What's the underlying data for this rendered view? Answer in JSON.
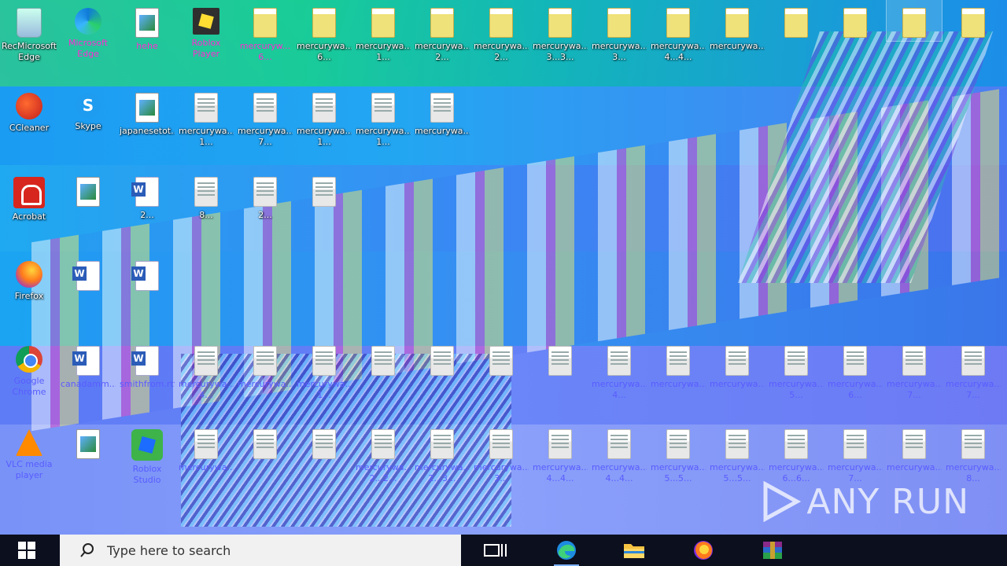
{
  "desktop": {
    "row1": [
      {
        "name": "recycle-bin",
        "l1": "RecMicrosoft",
        "l2": "Edge",
        "type": "bin"
      },
      {
        "name": "microsoft-edge",
        "l1": "Microsoft",
        "l2": "Edge",
        "type": "edge"
      },
      {
        "name": "hehe",
        "l1": "hehe",
        "l2": "",
        "type": "img"
      },
      {
        "name": "roblox-player",
        "l1": "Roblox",
        "l2": "Player",
        "type": "roblox"
      },
      {
        "name": "mercurywa-1",
        "l1": "mercuryw...",
        "l2": "6...",
        "type": "ydoc"
      },
      {
        "name": "mercurywa-2",
        "l1": "mercurywa...",
        "l2": "6...",
        "type": "ydoc"
      },
      {
        "name": "mercurywa-3",
        "l1": "mercurywa...",
        "l2": "1...",
        "type": "ydoc"
      },
      {
        "name": "mercurywa-4",
        "l1": "mercurywa...",
        "l2": "2...",
        "type": "ydoc"
      },
      {
        "name": "mercurywa-5",
        "l1": "mercurywa...",
        "l2": "2...",
        "type": "ydoc"
      },
      {
        "name": "mercurywa-6",
        "l1": "mercurywa...",
        "l2": "3...3...",
        "type": "ydoc"
      },
      {
        "name": "mercurywa-7",
        "l1": "mercurywa...",
        "l2": "3...",
        "type": "ydoc"
      },
      {
        "name": "mercurywa-8",
        "l1": "mercurywa...",
        "l2": "4...4...",
        "type": "ydoc"
      },
      {
        "name": "mercurywa-9",
        "l1": "mercurywa...",
        "l2": "",
        "type": "ydoc"
      },
      {
        "name": "mercurywa-10",
        "l1": "",
        "l2": "",
        "type": "ydoc"
      },
      {
        "name": "mercurywa-11",
        "l1": "",
        "l2": "",
        "type": "ydoc"
      },
      {
        "name": "mercurywa-12",
        "l1": "",
        "l2": "",
        "type": "ydoc"
      },
      {
        "name": "mercurywa-13",
        "l1": "",
        "l2": "",
        "type": "ydoc"
      }
    ],
    "row2": [
      {
        "name": "ccleaner",
        "l1": "CCleaner",
        "l2": "",
        "type": "ccleaner"
      },
      {
        "name": "skype",
        "l1": "Skype",
        "l2": "",
        "type": "skype",
        "glyph": "S"
      },
      {
        "name": "japanesetot",
        "l1": "japanesetot...",
        "l2": "",
        "type": "img"
      },
      {
        "name": "mercurywa-r2-1",
        "l1": "mercurywa...",
        "l2": "1...",
        "type": "doc"
      },
      {
        "name": "mercurywa-r2-2",
        "l1": "mercurywa...",
        "l2": "7...",
        "type": "doc"
      },
      {
        "name": "mercurywa-r2-3",
        "l1": "mercurywa...",
        "l2": "1...",
        "type": "doc"
      },
      {
        "name": "mercurywa-r2-4",
        "l1": "mercurywa...",
        "l2": "1...",
        "type": "doc"
      },
      {
        "name": "mercurywa-r2-5",
        "l1": "mercurywa...",
        "l2": "",
        "type": "doc"
      }
    ],
    "row3": [
      {
        "name": "acrobat",
        "l1": "Acrobat",
        "l2": "",
        "type": "acrobat"
      },
      {
        "name": "file-r3-1",
        "l1": "",
        "l2": "",
        "type": "img"
      },
      {
        "name": "word-r3-1",
        "l1": "",
        "l2": "2...",
        "type": "word"
      },
      {
        "name": "file-r3-2",
        "l1": "",
        "l2": "8...",
        "type": "doc"
      },
      {
        "name": "file-r3-3",
        "l1": "",
        "l2": "2...",
        "type": "doc"
      },
      {
        "name": "file-r3-4",
        "l1": "",
        "l2": "",
        "type": "doc"
      }
    ],
    "row4": [
      {
        "name": "firefox",
        "l1": "Firefox",
        "l2": "",
        "type": "firefox"
      },
      {
        "name": "word-r4-1",
        "l1": "",
        "l2": "",
        "type": "word"
      },
      {
        "name": "word-r4-2",
        "l1": "",
        "l2": "",
        "type": "word"
      }
    ],
    "row5": [
      {
        "name": "google-chrome",
        "l1": "Google",
        "l2": "Chrome",
        "type": "chrome"
      },
      {
        "name": "canadamm",
        "l1": "canadamm...",
        "l2": "",
        "type": "word"
      },
      {
        "name": "smithfrom",
        "l1": "smithfrom.rtf",
        "l2": "",
        "type": "word"
      },
      {
        "name": "mercurywa-r5-1",
        "l1": "mercurywa...",
        "l2": "4...",
        "type": "doc"
      },
      {
        "name": "mercurywa-r5-2",
        "l1": "mercurywa...",
        "l2": "",
        "type": "doc"
      },
      {
        "name": "mercurywa-r5-3",
        "l1": "mercurywa...",
        "l2": "1...",
        "type": "doc"
      },
      {
        "name": "mercurywa-r5-4",
        "l1": "",
        "l2": "",
        "type": "doc"
      },
      {
        "name": "mercurywa-r5-5",
        "l1": "",
        "l2": "",
        "type": "doc"
      },
      {
        "name": "mercurywa-r5-6",
        "l1": "",
        "l2": "",
        "type": "doc"
      },
      {
        "name": "mercurywa-r5-7",
        "l1": "",
        "l2": "",
        "type": "doc"
      },
      {
        "name": "mercurywa-r5-8",
        "l1": "mercurywa...",
        "l2": "4...",
        "type": "doc"
      },
      {
        "name": "mercurywa-r5-9",
        "l1": "mercurywa...",
        "l2": "",
        "type": "doc"
      },
      {
        "name": "mercurywa-r5-10",
        "l1": "mercurywa...",
        "l2": "",
        "type": "doc"
      },
      {
        "name": "mercurywa-r5-11",
        "l1": "mercurywa...",
        "l2": "5...",
        "type": "doc"
      },
      {
        "name": "mercurywa-r5-12",
        "l1": "mercurywa...",
        "l2": "6...",
        "type": "doc"
      },
      {
        "name": "mercurywa-r5-13",
        "l1": "mercurywa...",
        "l2": "7...",
        "type": "doc"
      },
      {
        "name": "mercurywa-r5-14",
        "l1": "mercurywa...",
        "l2": "7...",
        "type": "doc"
      }
    ],
    "row6": [
      {
        "name": "vlc-player",
        "l1": "VLC media",
        "l2": "player",
        "type": "vlc"
      },
      {
        "name": "file-r6-1",
        "l1": "",
        "l2": "",
        "type": "img"
      },
      {
        "name": "roblox-studio",
        "l1": "Roblox",
        "l2": "Studio",
        "type": "studio"
      },
      {
        "name": "mercurywa-r6-1",
        "l1": "mercurywa...",
        "l2": "",
        "type": "doc"
      },
      {
        "name": "mercurywa-r6-2",
        "l1": "",
        "l2": "",
        "type": "doc"
      },
      {
        "name": "mercurywa-r6-3",
        "l1": "",
        "l2": "",
        "type": "doc"
      },
      {
        "name": "mercurywa-r6-4",
        "l1": "mercurywa...",
        "l2": "2...2...",
        "type": "doc"
      },
      {
        "name": "mercurywa-r6-5",
        "l1": "mercurywa...",
        "l2": "2...3...",
        "type": "doc"
      },
      {
        "name": "mercurywa-r6-6",
        "l1": "mercurywa...",
        "l2": "3...",
        "type": "doc"
      },
      {
        "name": "mercurywa-r6-7",
        "l1": "mercurywa...",
        "l2": "4...4...",
        "type": "doc"
      },
      {
        "name": "mercurywa-r6-8",
        "l1": "mercurywa...",
        "l2": "4...4...",
        "type": "doc"
      },
      {
        "name": "mercurywa-r6-9",
        "l1": "mercurywa...",
        "l2": "5...5...",
        "type": "doc"
      },
      {
        "name": "mercurywa-r6-10",
        "l1": "mercurywa...",
        "l2": "5...5...",
        "type": "doc"
      },
      {
        "name": "mercurywa-r6-11",
        "l1": "mercurywa...",
        "l2": "6...6...",
        "type": "doc"
      },
      {
        "name": "mercurywa-r6-12",
        "l1": "mercurywa...",
        "l2": "7...",
        "type": "doc"
      },
      {
        "name": "mercurywa-r6-13",
        "l1": "mercurywa...",
        "l2": "",
        "type": "doc"
      },
      {
        "name": "mercurywa-r6-14",
        "l1": "mercurywa...",
        "l2": "8...",
        "type": "doc"
      }
    ]
  },
  "watermark": {
    "text": "ANY RUN"
  },
  "taskbar": {
    "search_placeholder": "Type here to search",
    "start_icon": "windows-start-icon",
    "buttons": [
      {
        "name": "task-view",
        "icon": "task-view-icon"
      },
      {
        "name": "edge",
        "icon": "edge-icon"
      },
      {
        "name": "file-explorer",
        "icon": "folder-icon"
      },
      {
        "name": "firefox",
        "icon": "firefox-icon"
      },
      {
        "name": "winrar",
        "icon": "winrar-icon"
      }
    ]
  },
  "colors": {
    "taskbar": "#0c0f1e",
    "accent": "#7bb1ff",
    "label_glitch": "#ff2bd0"
  }
}
